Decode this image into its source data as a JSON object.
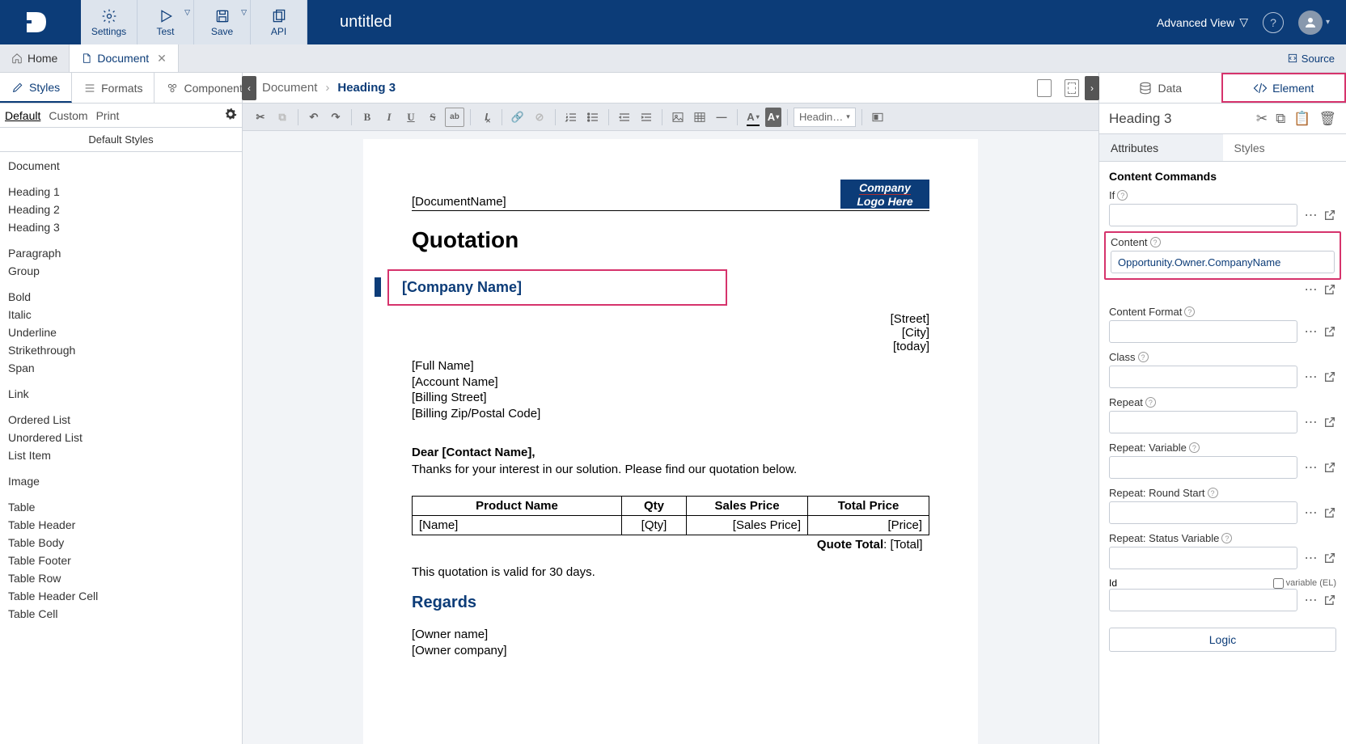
{
  "topbar": {
    "buttons": {
      "settings": "Settings",
      "test": "Test",
      "save": "Save",
      "api": "API"
    },
    "docTitle": "untitled",
    "advView": "Advanced View"
  },
  "tabs": {
    "home": "Home",
    "document": "Document",
    "source": "Source"
  },
  "leftPanel": {
    "tabs": {
      "styles": "Styles",
      "formats": "Formats",
      "components": "Components"
    },
    "subtabs": {
      "default": "Default",
      "custom": "Custom",
      "print": "Print"
    },
    "header": "Default Styles",
    "items": [
      "Document",
      "",
      "Heading 1",
      "Heading 2",
      "Heading 3",
      "",
      "Paragraph",
      "Group",
      "",
      "Bold",
      "Italic",
      "Underline",
      "Strikethrough",
      "Span",
      "",
      "Link",
      "",
      "Ordered List",
      "Unordered List",
      "List Item",
      "",
      "Image",
      "",
      "Table",
      "Table Header",
      "Table Body",
      "Table Footer",
      "Table Row",
      "Table Header Cell",
      "Table Cell"
    ]
  },
  "breadcrumb": {
    "document": "Document",
    "heading3": "Heading 3"
  },
  "toolbar": {
    "headingSelect": "Headin…"
  },
  "doc": {
    "docName": "[DocumentName]",
    "logo1": "Company",
    "logo2": "Logo Here",
    "quotation": "Quotation",
    "companyName": "[Company Name]",
    "street": "[Street]",
    "city": "[City]",
    "today": "[today]",
    "fullName": "[Full Name]",
    "accountName": "[Account Name]",
    "billingStreet": "[Billing Street]",
    "billingZip": "[Billing Zip/Postal Code]",
    "dear": "Dear [Contact Name],",
    "thanks": "Thanks for your interest in our solution. Please find our quotation below.",
    "th": {
      "product": "Product Name",
      "qty": "Qty",
      "sales": "Sales Price",
      "total": "Total Price"
    },
    "td": {
      "name": "[Name]",
      "qty": "[Qty]",
      "sales": "[Sales Price]",
      "price": "[Price]"
    },
    "quoteTotalLabel": "Quote Total",
    "quoteTotalVal": "[Total]",
    "valid": "This quotation is valid for 30 days.",
    "regards": "Regards",
    "ownerName": "[Owner name]",
    "ownerCompany": "[Owner company]"
  },
  "rightPanel": {
    "tabs": {
      "data": "Data",
      "element": "Element"
    },
    "title": "Heading 3",
    "subtabs": {
      "attributes": "Attributes",
      "styles": "Styles"
    },
    "sectionTitle": "Content Commands",
    "fields": {
      "if": "If",
      "content": "Content",
      "contentFormat": "Content Format",
      "class": "Class",
      "repeat": "Repeat",
      "repeatVar": "Repeat: Variable",
      "repeatRound": "Repeat: Round Start",
      "repeatStatus": "Repeat: Status Variable",
      "id": "Id",
      "variableEL": "variable (EL)"
    },
    "contentValue": "Opportunity.Owner.CompanyName",
    "logic": "Logic"
  }
}
